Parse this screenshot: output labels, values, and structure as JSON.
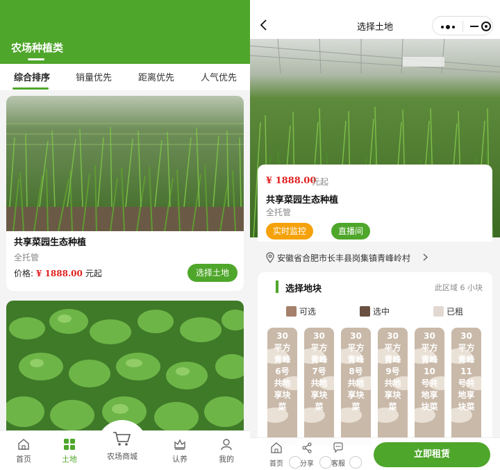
{
  "left": {
    "header_title": "农场种植类",
    "tabs": [
      {
        "label": "综合排序"
      },
      {
        "label": "销量优先"
      },
      {
        "label": "距离优先"
      },
      {
        "label": "人气优先"
      }
    ],
    "cards": [
      {
        "name": "共享菜园生态种植",
        "sub": "全托管",
        "price_label": "价格:",
        "price": "¥ 1888.00",
        "price_unit": "元起",
        "button": "选择土地"
      }
    ],
    "tabbar": [
      {
        "label": "首页",
        "icon": "home-icon"
      },
      {
        "label": "土地",
        "icon": "grid-icon"
      },
      {
        "label": "农场商城",
        "icon": "cart-icon"
      },
      {
        "label": "认养",
        "icon": "crown-icon"
      },
      {
        "label": "我的",
        "icon": "user-icon"
      }
    ],
    "accent": "#4ea62a"
  },
  "right": {
    "nav_title": "选择土地",
    "price": "¥ 1888.00",
    "price_unit": "元起",
    "name": "共享菜园生态种植",
    "sub": "全托管",
    "pills": [
      "实时监控",
      "直播间"
    ],
    "address": "安徽省合肥市长丰县岗集镇青峰岭村",
    "section_title": "选择地块",
    "section_count": "此区域 6 小块",
    "legend": [
      {
        "label": "可选",
        "color": "#a5806a"
      },
      {
        "label": "选中",
        "color": "#6a5040"
      },
      {
        "label": "已租",
        "color": "#e2d8d2"
      }
    ],
    "plots": [
      {
        "label": "30平方青峰6号共地享块菜"
      },
      {
        "label": "30平方青峰7号共地享块菜"
      },
      {
        "label": "30平方青峰8号共地享块菜"
      },
      {
        "label": "30平方青峰9号共地享块菜"
      },
      {
        "label": "30平方青峰10号共地享块菜"
      },
      {
        "label": "30平方青峰11号共地享块菜"
      }
    ],
    "bottom": [
      {
        "label": "首页",
        "icon": "home-icon"
      },
      {
        "label": "分享",
        "icon": "share-icon"
      },
      {
        "label": "客服",
        "icon": "chat-icon"
      }
    ],
    "rent_button": "立即租赁"
  }
}
